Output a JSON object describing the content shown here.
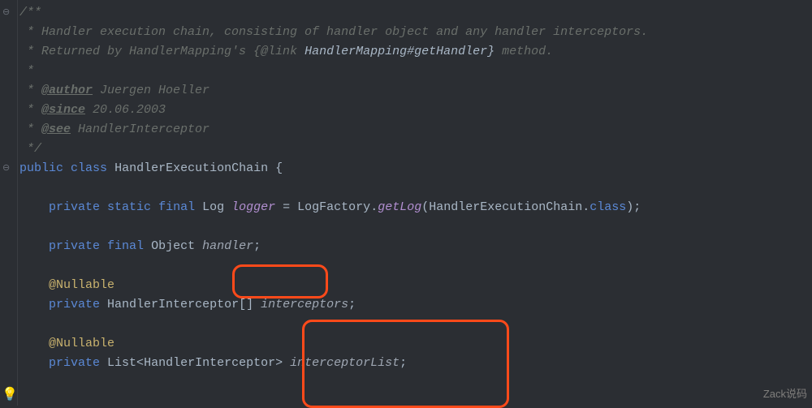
{
  "watermark": "Zack说码",
  "code": {
    "javadoc": {
      "open": "/**",
      "desc1": " * Handler execution chain, consisting of handler object and any handler interceptors.",
      "desc2a": " * Returned by HandlerMapping's ",
      "link_prefix": "{@link",
      "link_target": " HandlerMapping#getHandler}",
      "desc2b": " method.",
      "empty": " *",
      "author_tag": "@author",
      "author_val": " Juergen Hoeller",
      "since_tag": "@since",
      "since_val": " 20.06.2003",
      "see_tag": "@see",
      "see_val": " HandlerInterceptor",
      "close": " */"
    },
    "class": {
      "kw_public": "public",
      "kw_class": "class",
      "name": "HandlerExecutionChain",
      "brace": " {"
    },
    "logger": {
      "kw_private": "private",
      "kw_static": "static",
      "kw_final": "final",
      "type": "Log",
      "name": "logger",
      "eq": " = ",
      "factory": "LogFactory",
      "dot": ".",
      "method": "getLog",
      "arg": "(HandlerExecutionChain.",
      "cls": "class",
      "end": ");"
    },
    "handler": {
      "kw_private": "private",
      "kw_final": "final",
      "type": "Object",
      "name": "handler",
      "end": ";"
    },
    "interceptors": {
      "anno": "@Nullable",
      "kw_private": "private",
      "type": "HandlerInterceptor[]",
      "name": "interceptors",
      "end": ";"
    },
    "list": {
      "anno": "@Nullable",
      "kw_private": "private",
      "type1": "List<",
      "type2": "HandlerInterceptor",
      "type3": ">",
      "name": "interceptorList",
      "end": ";"
    }
  }
}
